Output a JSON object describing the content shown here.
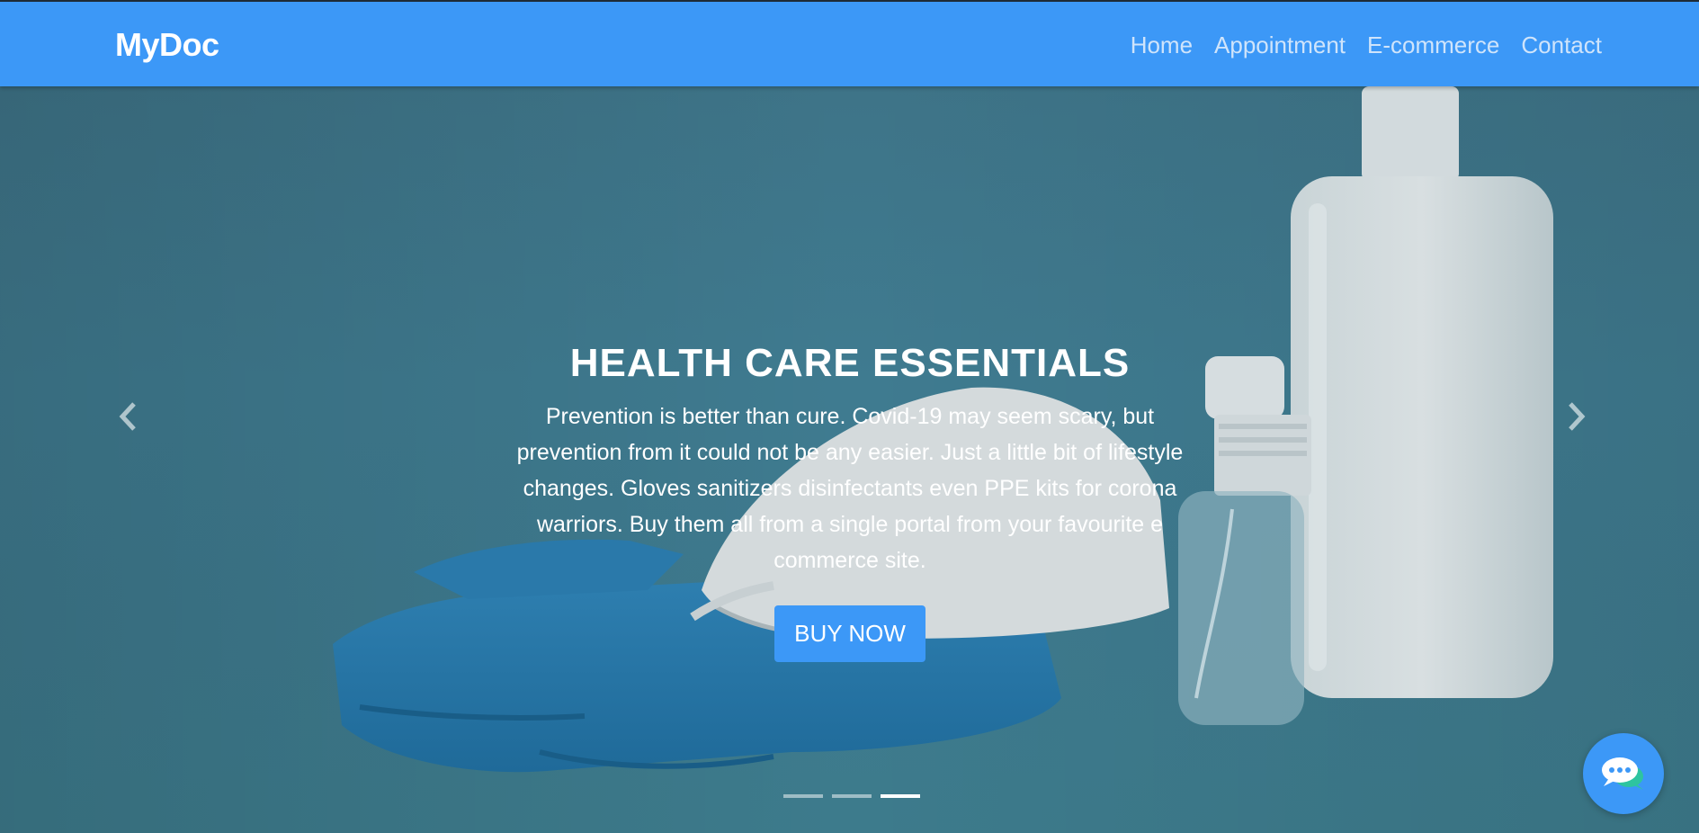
{
  "navbar": {
    "brand": "MyDoc",
    "links": [
      "Home",
      "Appointment",
      "E-commerce",
      "Contact"
    ]
  },
  "hero": {
    "title": "HEALTH CARE ESSENTIALS",
    "text": "Prevention is better than cure. Covid-19 may seem scary, but prevention from it could not be any easier. Just a little bit of lifestyle changes. Gloves sanitizers disinfectants even PPE kits for corona warriors. Buy them all from a single portal from your favourite e commerce site.",
    "button": "BUY NOW",
    "slides_count": 3,
    "active_slide": 3
  },
  "icons": {
    "prev": "chevron-left-icon",
    "next": "chevron-right-icon",
    "chat": "chat-bubbles-icon"
  },
  "colors": {
    "brand_blue": "#3c98f7",
    "hero_bg": "#3f7b90",
    "text": "#ffffff"
  }
}
